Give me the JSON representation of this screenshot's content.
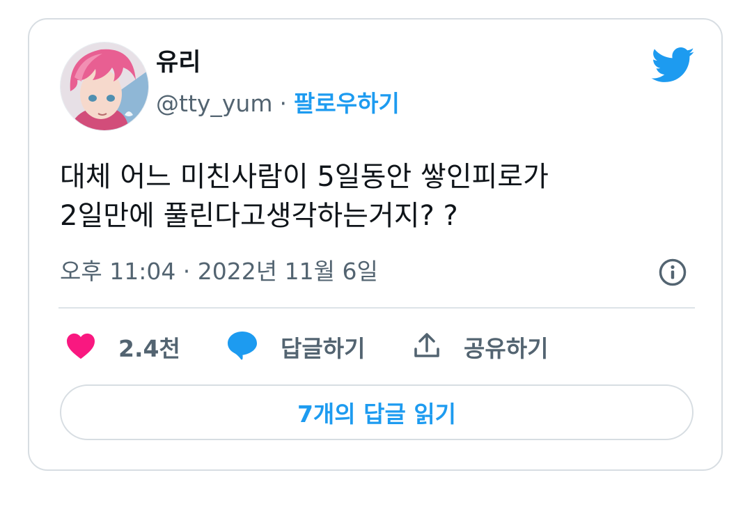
{
  "author": {
    "display_name": "유리",
    "handle": "@tty_yum",
    "separator": "·",
    "follow_label": "팔로우하기"
  },
  "tweet": {
    "lines": [
      "대체 어느 미친사람이 5일동안 쌓인피로가",
      "2일만에 풀린다고생각하는거지? ?"
    ],
    "timestamp": "오후 11:04 · 2022년 11월 6일"
  },
  "actions": {
    "like_count": "2.4천",
    "reply_label": "답글하기",
    "share_label": "공유하기"
  },
  "read_replies_label": "7개의 답글 읽기",
  "colors": {
    "brand_blue": "#1d9bf0",
    "like_pink": "#f91880",
    "muted_text": "#536471",
    "border": "#d7dde2"
  },
  "icons": [
    "avatar",
    "twitter-bird-icon",
    "info-icon",
    "heart-icon",
    "reply-bubble-icon",
    "share-icon"
  ]
}
